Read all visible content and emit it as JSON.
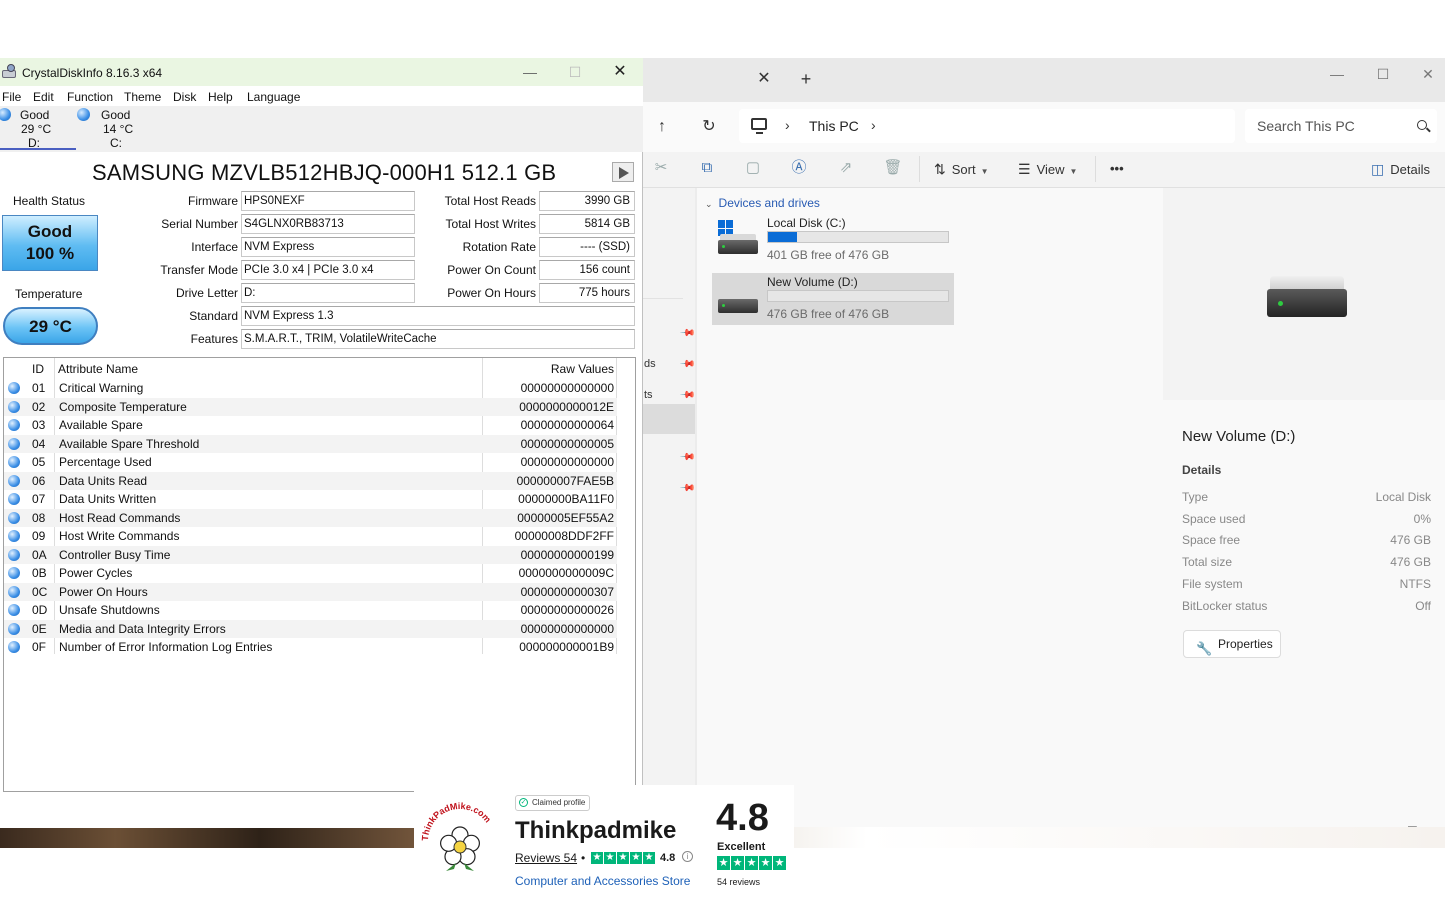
{
  "explorer": {
    "address": {
      "location": "This PC"
    },
    "search": {
      "placeholder": "Search This PC"
    },
    "toolbar": {
      "sort": "Sort",
      "view": "View",
      "more": "•••",
      "details": "Details"
    },
    "nav_fragments": [
      "ds",
      "ts"
    ],
    "group_label": "Devices and drives",
    "drives": [
      {
        "name": "Local Disk (C:)",
        "free": "401 GB free of 476 GB",
        "used_fraction": 0.16
      },
      {
        "name": "New Volume (D:)",
        "free": "476 GB free of 476 GB",
        "used_fraction": 0.0
      }
    ],
    "details": {
      "title": "New Volume (D:)",
      "section": "Details",
      "rows": [
        {
          "key": "Type",
          "value": "Local Disk"
        },
        {
          "key": "Space used",
          "value": "0%"
        },
        {
          "key": "Space free",
          "value": "476 GB"
        },
        {
          "key": "Total size",
          "value": "476 GB"
        },
        {
          "key": "File system",
          "value": "NTFS"
        },
        {
          "key": "BitLocker status",
          "value": "Off"
        }
      ],
      "properties_button": "Properties"
    }
  },
  "cdi": {
    "title": "CrystalDiskInfo 8.16.3 x64",
    "menu": [
      "File",
      "Edit",
      "Function",
      "Theme",
      "Disk",
      "Help",
      "Language"
    ],
    "disks": [
      {
        "status": "Good",
        "temp": "29 °C",
        "letter": "D:"
      },
      {
        "status": "Good",
        "temp": "14 °C",
        "letter": "C:"
      }
    ],
    "model": "SAMSUNG MZVLB512HBJQ-000H1 512.1 GB",
    "health_label": "Health Status",
    "health_status": "Good",
    "health_percent": "100 %",
    "temperature_label": "Temperature",
    "temperature": "29 °C",
    "info_left": [
      {
        "label": "Firmware",
        "value": "HPS0NEXF"
      },
      {
        "label": "Serial Number",
        "value": "S4GLNX0RB83713"
      },
      {
        "label": "Interface",
        "value": "NVM Express"
      },
      {
        "label": "Transfer Mode",
        "value": "PCIe 3.0 x4 | PCIe 3.0 x4"
      },
      {
        "label": "Drive Letter",
        "value": "D:"
      },
      {
        "label": "Standard",
        "value": "NVM Express 1.3"
      },
      {
        "label": "Features",
        "value": "S.M.A.R.T., TRIM, VolatileWriteCache"
      }
    ],
    "info_right": [
      {
        "label": "Total Host Reads",
        "value": "3990 GB"
      },
      {
        "label": "Total Host Writes",
        "value": "5814 GB"
      },
      {
        "label": "Rotation Rate",
        "value": "---- (SSD)"
      },
      {
        "label": "Power On Count",
        "value": "156 count"
      },
      {
        "label": "Power On Hours",
        "value": "775 hours"
      }
    ],
    "attr_headers": {
      "id": "ID",
      "name": "Attribute Name",
      "raw": "Raw Values"
    },
    "attributes": [
      {
        "id": "01",
        "name": "Critical Warning",
        "raw": "00000000000000"
      },
      {
        "id": "02",
        "name": "Composite Temperature",
        "raw": "0000000000012E"
      },
      {
        "id": "03",
        "name": "Available Spare",
        "raw": "00000000000064"
      },
      {
        "id": "04",
        "name": "Available Spare Threshold",
        "raw": "00000000000005"
      },
      {
        "id": "05",
        "name": "Percentage Used",
        "raw": "00000000000000"
      },
      {
        "id": "06",
        "name": "Data Units Read",
        "raw": "000000007FAE5B"
      },
      {
        "id": "07",
        "name": "Data Units Written",
        "raw": "00000000BA11F0"
      },
      {
        "id": "08",
        "name": "Host Read Commands",
        "raw": "00000005EF55A2"
      },
      {
        "id": "09",
        "name": "Host Write Commands",
        "raw": "00000008DDF2FF"
      },
      {
        "id": "0A",
        "name": "Controller Busy Time",
        "raw": "00000000000199"
      },
      {
        "id": "0B",
        "name": "Power Cycles",
        "raw": "0000000000009C"
      },
      {
        "id": "0C",
        "name": "Power On Hours",
        "raw": "00000000000307"
      },
      {
        "id": "0D",
        "name": "Unsafe Shutdowns",
        "raw": "00000000000026"
      },
      {
        "id": "0E",
        "name": "Media and Data Integrity Errors",
        "raw": "00000000000000"
      },
      {
        "id": "0F",
        "name": "Number of Error Information Log Entries",
        "raw": "000000000001B9"
      }
    ]
  },
  "badge": {
    "logo_text": "ThinkPadMike.com",
    "claimed": "Claimed profile",
    "name": "Thinkpadmike",
    "reviews": "Reviews 54",
    "score_small": "4.8",
    "category": "Computer and Accessories Store",
    "score": "4.8",
    "rating_word": "Excellent",
    "count": "54 reviews",
    "star_color": "#00b67a"
  }
}
